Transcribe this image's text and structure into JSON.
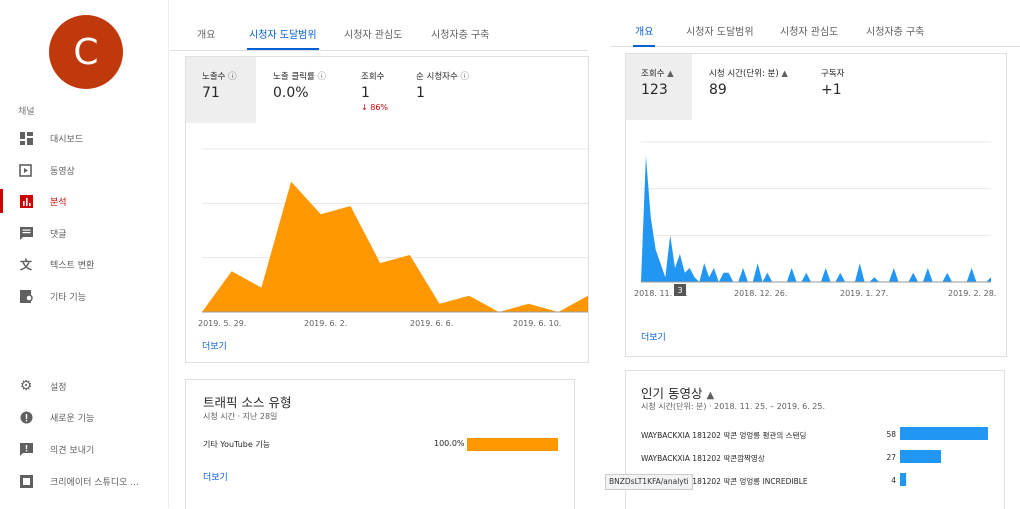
{
  "sidebar": {
    "avatar_letter": "C",
    "section_label": "채널",
    "items": [
      {
        "label": "대시보드",
        "icon": "dashboard-icon"
      },
      {
        "label": "동영상",
        "icon": "video-icon"
      },
      {
        "label": "분석",
        "icon": "analytics-icon",
        "active": true
      },
      {
        "label": "댓글",
        "icon": "comment-icon"
      },
      {
        "label": "텍스트 변환",
        "icon": "translate-icon"
      },
      {
        "label": "기타 기능",
        "icon": "other-features-icon"
      }
    ],
    "bottom_items": [
      {
        "label": "설정",
        "icon": "gear-icon"
      },
      {
        "label": "새로운 기능",
        "icon": "new-feature-icon"
      },
      {
        "label": "의견 보내기",
        "icon": "feedback-icon"
      },
      {
        "label": "크리에이터 스튜디오 ...",
        "icon": "creator-studio-icon"
      }
    ]
  },
  "left": {
    "tabs": [
      "개요",
      "시청자 도달범위",
      "시청자 관심도",
      "시청자층 구축"
    ],
    "active_tab": 1,
    "metrics": [
      {
        "label": "노출수",
        "value": "71",
        "info": true
      },
      {
        "label": "노출 클릭률",
        "value": "0.0%",
        "info": true
      },
      {
        "label": "조회수",
        "value": "1",
        "change": "↓ 86%"
      },
      {
        "label": "순 시청자수",
        "value": "1",
        "info": true
      }
    ],
    "more_link": "더보기",
    "traffic": {
      "title": "트래픽 소스 유형",
      "subtitle": "시청 시간 · 지난 28일",
      "rows": [
        {
          "label": "기타 YouTube 기능",
          "value": "100.0%",
          "fraction": 1.0
        }
      ],
      "more_link": "더보기"
    }
  },
  "right": {
    "tabs": [
      "개요",
      "시청자 도달범위",
      "시청자 관심도",
      "시청자층 구축"
    ],
    "active_tab": 0,
    "metrics": [
      {
        "label": "조회수",
        "value": "123",
        "warn": true
      },
      {
        "label": "시청 시간(단위: 분)",
        "value": "89",
        "warn": true
      },
      {
        "label": "구독자",
        "value": "+1"
      }
    ],
    "marker_label": "3",
    "more_link": "더보기",
    "top_videos": {
      "title": "인기 동영상",
      "subtitle": "시청 시간(단위: 분) · 2018. 11. 25. – 2019. 6. 25.",
      "rows": [
        {
          "label": "WAYBACKXIA 181202 딱콘 엉엉릉 평관의 스탠딩",
          "value": "58"
        },
        {
          "label": "WAYBACKXIA 181202 딱콘깜짝영상",
          "value": "27"
        },
        {
          "label": "WAYBACKXIA 181202 딱콘 엉엉릉 INCREDIBLE",
          "value": "4"
        }
      ],
      "url_fragment": "BNZDsLT1KFA/analyti"
    }
  },
  "chart_data": [
    {
      "type": "area",
      "x": [
        "2019. 5. 29.",
        "2019. 5. 30.",
        "2019. 5. 31.",
        "2019. 6. 1.",
        "2019. 6. 2.",
        "2019. 6. 3.",
        "2019. 6. 4.",
        "2019. 6. 5.",
        "2019. 6. 6.",
        "2019. 6. 7.",
        "2019. 6. 8.",
        "2019. 6. 9.",
        "2019. 6. 10.",
        "2019. 6. 11."
      ],
      "values": [
        0,
        5,
        3,
        16,
        12,
        13,
        6,
        7,
        1,
        2,
        0,
        1,
        0,
        2
      ],
      "x_tick_labels": [
        "2019. 5. 29.",
        "2019. 6. 2.",
        "2019. 6. 6.",
        "2019. 6. 10."
      ],
      "ylim": [
        0,
        20
      ],
      "color": "#ff9800",
      "grid": true
    },
    {
      "type": "area",
      "x_tick_labels": [
        "2018. 11. 25.",
        "2018. 12. 26.",
        "2019. 1. 27.",
        "2019. 2. 28."
      ],
      "values": [
        0,
        27,
        14,
        7,
        4,
        1,
        10,
        3,
        6,
        2,
        3,
        1,
        0,
        4,
        1,
        3,
        0,
        2,
        2,
        0,
        0,
        3,
        0,
        0,
        4,
        0,
        2,
        0,
        0,
        0,
        0,
        3,
        0,
        0,
        2,
        0,
        0,
        0,
        3,
        0,
        0,
        2,
        0,
        0,
        0,
        4,
        0,
        0,
        1,
        0,
        0,
        0,
        3,
        0,
        0,
        0,
        2,
        0,
        0,
        3,
        0,
        0,
        0,
        2,
        0,
        0,
        0,
        0,
        3,
        0,
        0,
        0,
        1
      ],
      "ylim": [
        0,
        30
      ],
      "color": "#2196f3",
      "grid": true
    },
    {
      "type": "bar",
      "orientation": "horizontal",
      "categories": [
        "기타 YouTube 기능"
      ],
      "values": [
        100.0
      ],
      "color": "#ff9800"
    },
    {
      "type": "bar",
      "orientation": "horizontal",
      "categories": [
        "WAYBACKXIA 181202 딱콘 엉엉릉 평관의 스탠딩",
        "WAYBACKXIA 181202 딱콘깜짝영상",
        "WAYBACKXIA 181202 딱콘 엉엉릉 INCREDIBLE"
      ],
      "values": [
        58,
        27,
        4
      ],
      "color": "#2196f3"
    }
  ]
}
